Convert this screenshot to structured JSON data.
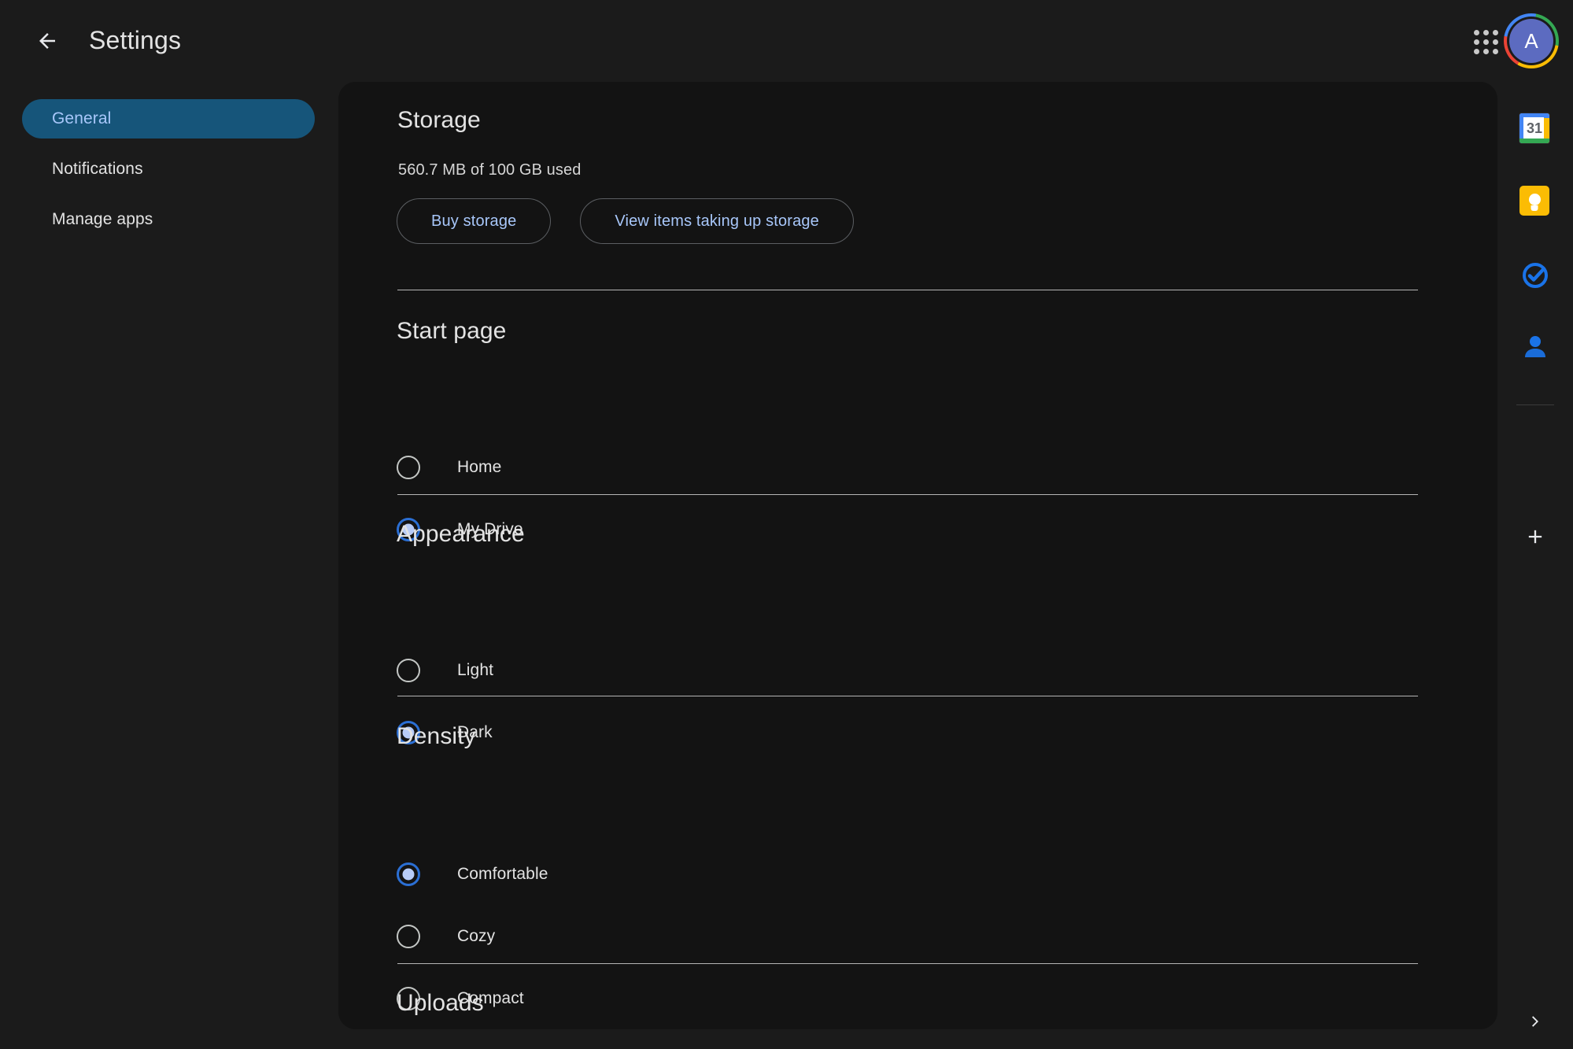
{
  "header": {
    "title": "Settings",
    "back_icon": "arrow-left-icon",
    "apps_icon": "apps-grid-icon",
    "avatar_letter": "A"
  },
  "sidebar": {
    "items": [
      {
        "label": "General",
        "active": true
      },
      {
        "label": "Notifications",
        "active": false
      },
      {
        "label": "Manage apps",
        "active": false
      }
    ]
  },
  "main": {
    "storage": {
      "heading": "Storage",
      "usage": "560.7 MB of 100 GB used",
      "buy_label": "Buy storage",
      "view_label": "View items taking up storage"
    },
    "start_page": {
      "heading": "Start page",
      "options": [
        {
          "label": "Home",
          "selected": false
        },
        {
          "label": "My Drive",
          "selected": true
        }
      ]
    },
    "appearance": {
      "heading": "Appearance",
      "options": [
        {
          "label": "Light",
          "selected": false
        },
        {
          "label": "Dark",
          "selected": true
        }
      ]
    },
    "density": {
      "heading": "Density",
      "options": [
        {
          "label": "Comfortable",
          "selected": true
        },
        {
          "label": "Cozy",
          "selected": false
        },
        {
          "label": "Compact",
          "selected": false
        }
      ]
    },
    "uploads": {
      "heading": "Uploads"
    }
  },
  "side_panel": {
    "icons": [
      {
        "name": "google-calendar-icon",
        "day": "31"
      },
      {
        "name": "google-keep-icon"
      },
      {
        "name": "google-tasks-icon"
      },
      {
        "name": "google-contacts-icon"
      }
    ],
    "add_icon": "plus-icon",
    "expand_icon": "chevron-right-icon"
  },
  "colors": {
    "page_bg": "#1b1b1b",
    "panel_bg": "#131313",
    "accent": "#a8c7fa",
    "nav_active_bg": "#16557a",
    "radio_selected_ring": "#2b6fd4",
    "radio_selected_dot": "#b8ccf7",
    "divider": "#b5b5b5",
    "text_primary": "#e3e3e3"
  }
}
